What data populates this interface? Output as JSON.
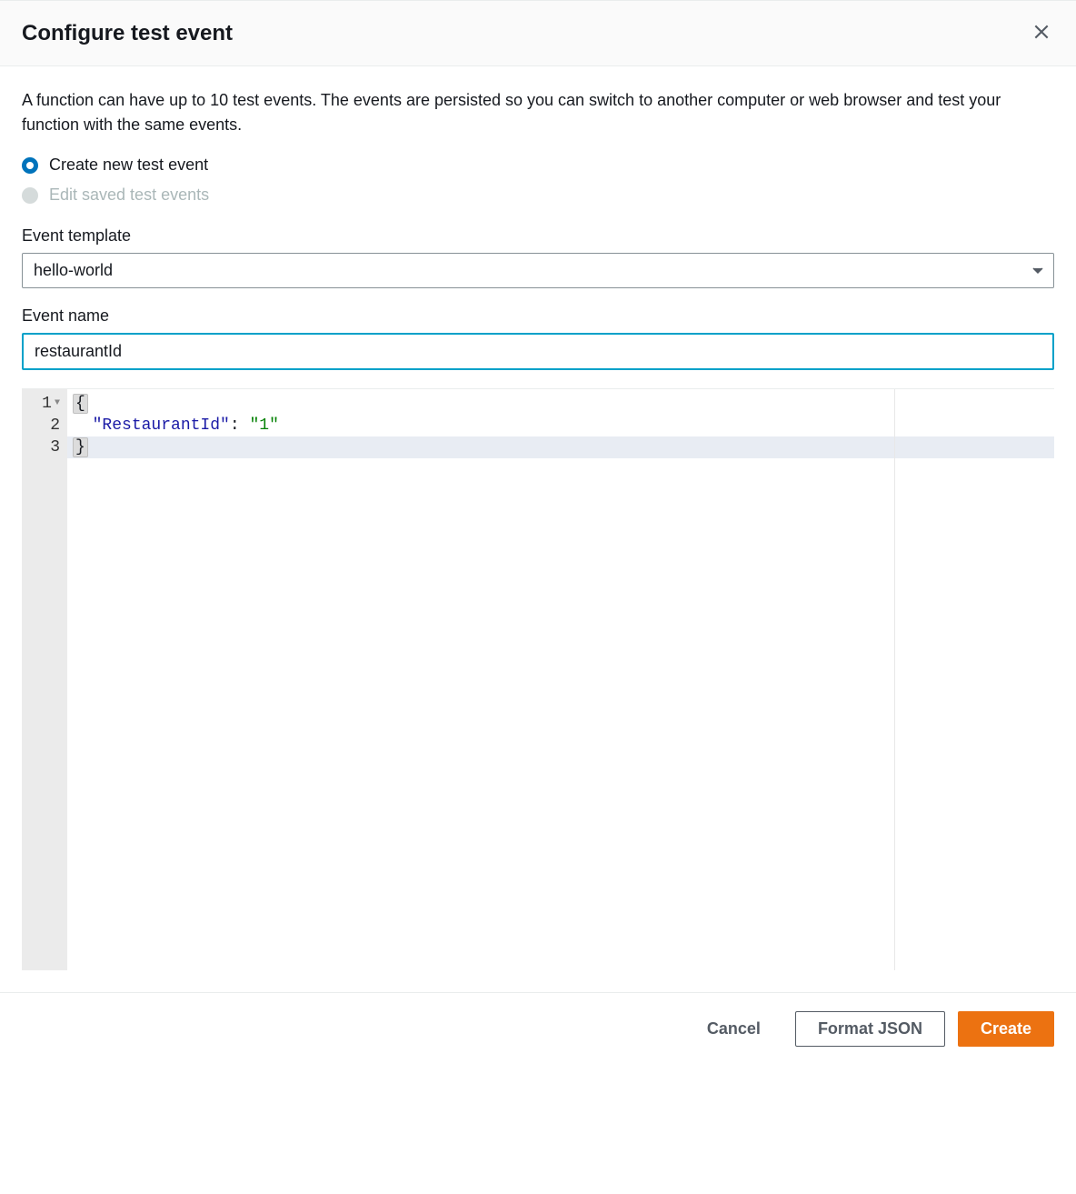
{
  "modal": {
    "title": "Configure test event",
    "description": "A function can have up to 10 test events. The events are persisted so you can switch to another computer or web browser and test your function with the same events."
  },
  "radio": {
    "create_label": "Create new test event",
    "edit_label": "Edit saved test events"
  },
  "form": {
    "template_label": "Event template",
    "template_value": "hello-world",
    "name_label": "Event name",
    "name_value": "restaurantId"
  },
  "editor": {
    "line1_n": "1",
    "line2_n": "2",
    "line3_n": "3",
    "brace_open": "{",
    "brace_close": "}",
    "key": "\"RestaurantId\"",
    "colon": ":",
    "value": "\"1\"",
    "indent": "  "
  },
  "footer": {
    "cancel": "Cancel",
    "format": "Format JSON",
    "create": "Create"
  }
}
